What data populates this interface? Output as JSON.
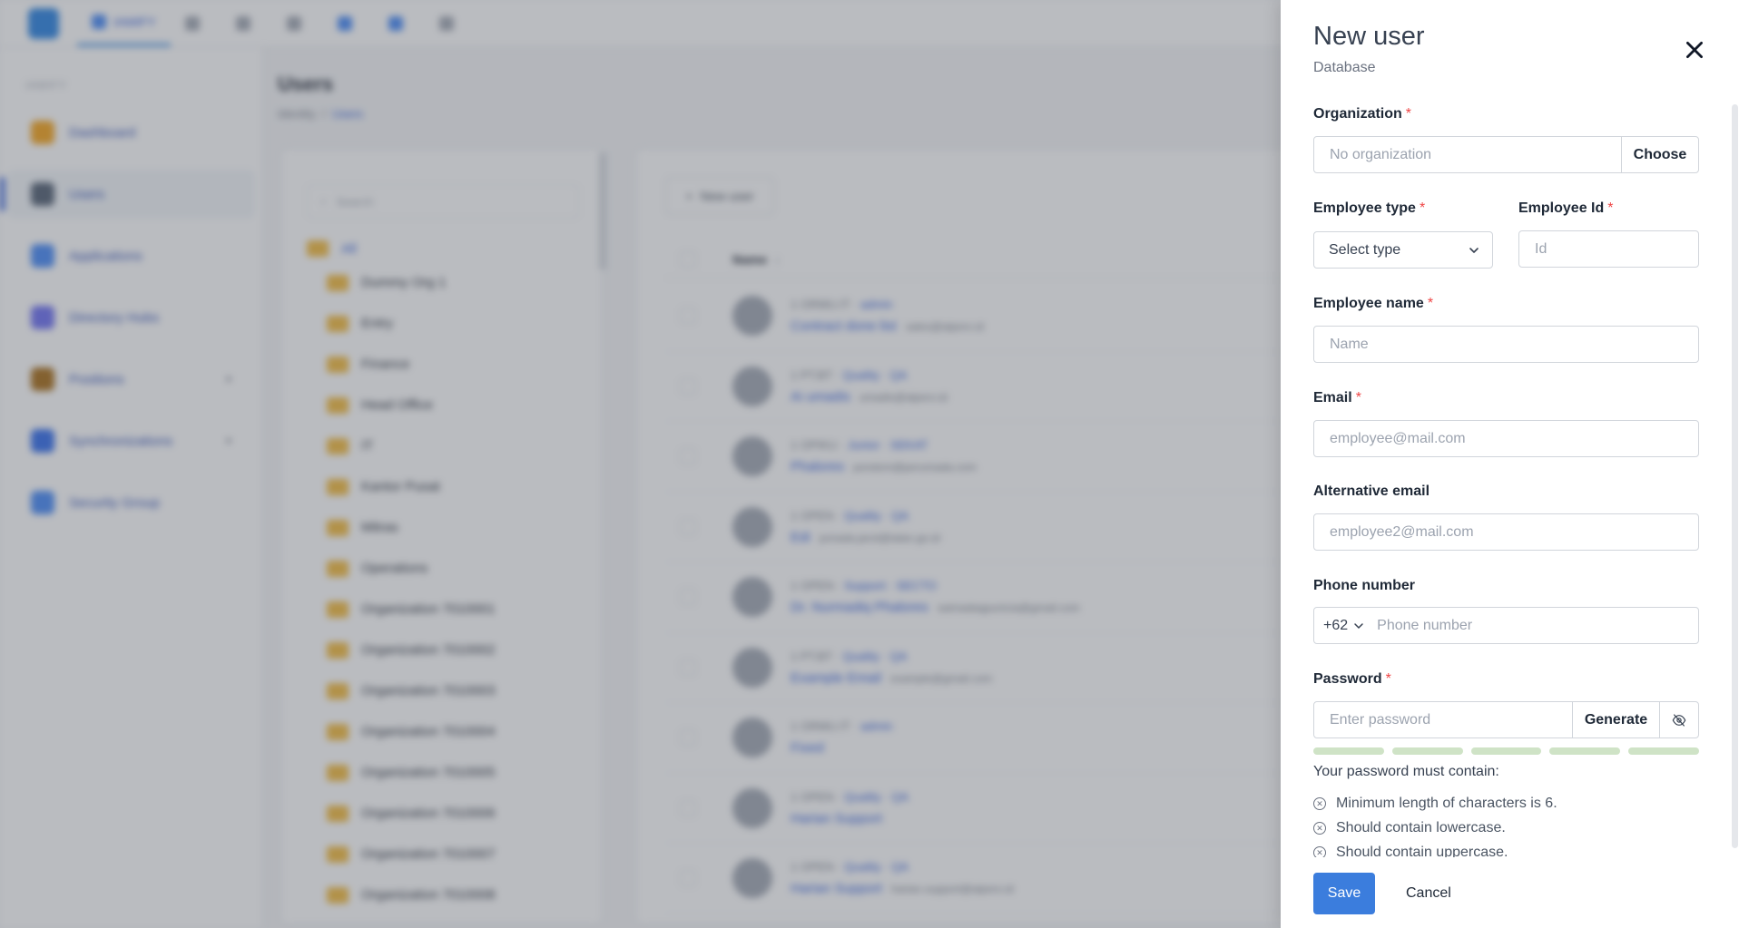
{
  "background": {
    "topnav": {
      "tabs": [
        "IAMIFY",
        "",
        "",
        "",
        "",
        "",
        ""
      ]
    },
    "sidebar": {
      "title": "IAMIFY",
      "items": [
        {
          "label": "Dashboard",
          "icon": "dashboard-icon",
          "color": "#f59e0b"
        },
        {
          "label": "Users",
          "icon": "users-icon",
          "color": "#475569"
        },
        {
          "label": "Applications",
          "icon": "applications-icon",
          "color": "#3b82f6"
        },
        {
          "label": "Directory Hubs",
          "icon": "directory-hubs-icon",
          "color": "#6366f1"
        },
        {
          "label": "Positions",
          "icon": "positions-icon",
          "color": "#a16207"
        },
        {
          "label": "Synchronizations",
          "icon": "synchronizations-icon",
          "color": "#2563eb"
        },
        {
          "label": "Security Group",
          "icon": "security-group-icon",
          "color": "#3b82f6"
        }
      ]
    },
    "page": {
      "title": "Users",
      "breadcrumb": [
        "Identity",
        "Users"
      ]
    },
    "tree": {
      "search_placeholder": "Search",
      "root": "All",
      "nodes": [
        "Dummy Org 1",
        "Entry",
        "Finance",
        "Head Office",
        "IT",
        "Kantor Pusat",
        "Mitras",
        "Operations",
        "Organization 7010001",
        "Organization 7010002",
        "Organization 7010003",
        "Organization 7010004",
        "Organization 7010005",
        "Organization 7010006",
        "Organization 7010007",
        "Organization 7010008"
      ]
    },
    "users_table": {
      "new_button": "New user",
      "name_header": "Name",
      "rows": [
        {
          "meta": "1 ORMU.IT",
          "tag": "admin",
          "name": "Contract done list",
          "email": "sales@alpero.id"
        },
        {
          "meta": "1 PT.BT",
          "tag": "Quality · QA",
          "name": "Ai umadis",
          "email": "umadis@alpero.id"
        },
        {
          "meta": "1 OPIKU",
          "tag": "Junior · SEKAT",
          "name": "Phalores",
          "email": "pondom@perumada.com"
        },
        {
          "meta": "1 OPEN",
          "tag": "Quality · QA",
          "name": "Edi",
          "email": "jumada.jarot@ialan.go.id"
        },
        {
          "meta": "1 OPEN",
          "tag": "Support · SECTO",
          "name": "Dr. Nurmadiq Phalores",
          "email": "saimadaqpunicia@gmail.com"
        },
        {
          "meta": "1 PT.BT",
          "tag": "Quality · QA",
          "name": "Example Email",
          "email": "example@gmail.com"
        },
        {
          "meta": "1 ORMU.IT",
          "tag": "admin",
          "name": "Fixed",
          "email": ""
        },
        {
          "meta": "1 OPEN",
          "tag": "Quality · QA",
          "name": "Harian Support",
          "email": ""
        },
        {
          "meta": "1 OPEN",
          "tag": "Quality · QA",
          "name": "Harian Support",
          "email": "harian.support@alpero.id"
        }
      ]
    }
  },
  "drawer": {
    "title": "New user",
    "subtitle": "Database",
    "required_mark": "*",
    "organization": {
      "label": "Organization",
      "placeholder": "No organization",
      "button": "Choose"
    },
    "employee_type": {
      "label": "Employee type",
      "value": "Select type"
    },
    "employee_id": {
      "label": "Employee Id",
      "placeholder": "Id"
    },
    "employee_name": {
      "label": "Employee name",
      "placeholder": "Name"
    },
    "email": {
      "label": "Email",
      "placeholder": "employee@mail.com"
    },
    "alt_email": {
      "label": "Alternative email",
      "placeholder": "employee2@mail.com"
    },
    "phone": {
      "label": "Phone number",
      "country_code": "+62",
      "placeholder": "Phone number"
    },
    "password": {
      "label": "Password",
      "placeholder": "Enter password",
      "generate_button": "Generate",
      "visibility_icon": "eye-off-icon",
      "strength_segments": 5,
      "strength_color": "#cfe3c6",
      "rules_title": "Your password must contain:",
      "rules": [
        "Minimum length of characters is 6.",
        "Should contain lowercase.",
        "Should contain uppercase."
      ]
    },
    "actions": {
      "save": "Save",
      "cancel": "Cancel"
    },
    "colors": {
      "primary": "#3b7ddd",
      "required": "#ef4444"
    }
  }
}
